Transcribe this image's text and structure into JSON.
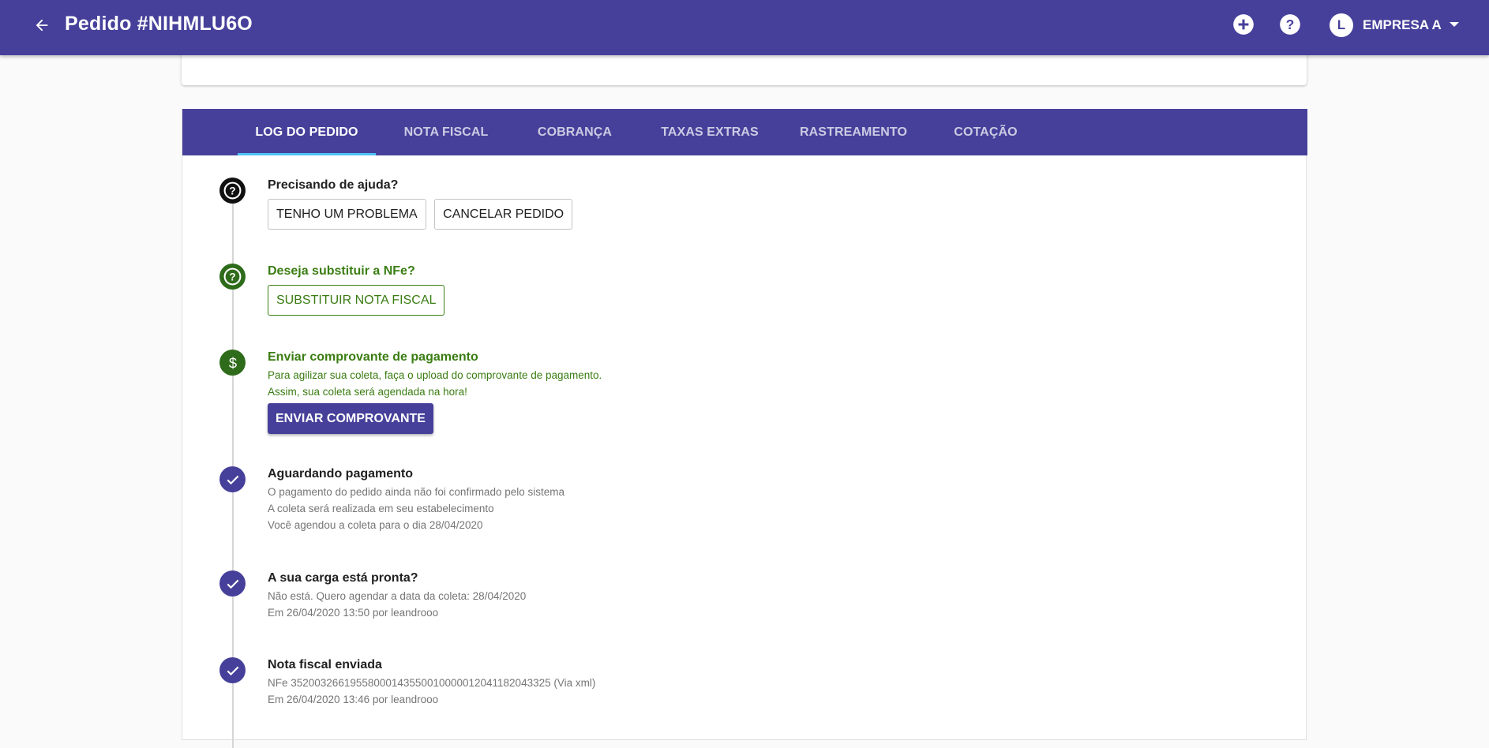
{
  "header": {
    "title": "Pedido #NIHMLU6O",
    "account_initial": "L",
    "account_name": "EMPRESA A"
  },
  "tabs": [
    {
      "label": "LOG DO PEDIDO",
      "active": true
    },
    {
      "label": "NOTA FISCAL",
      "active": false
    },
    {
      "label": "COBRANÇA",
      "active": false
    },
    {
      "label": "TAXAS EXTRAS",
      "active": false
    },
    {
      "label": "RASTREAMENTO",
      "active": false
    },
    {
      "label": "COTAÇÃO",
      "active": false
    }
  ],
  "timeline": {
    "help": {
      "icon": "help-circle-icon",
      "title": "Precisando de ajuda?",
      "button_problem": "TENHO UM PROBLEMA",
      "button_cancel": "CANCELAR PEDIDO"
    },
    "replace_nfe": {
      "icon": "help-circle-icon",
      "title": "Deseja substituir a NFe?",
      "button": "SUBSTITUIR NOTA FISCAL"
    },
    "payment_proof": {
      "icon": "dollar-icon",
      "title": "Enviar comprovante de pagamento",
      "line1": "Para agilizar sua coleta, faça o upload do comprovante de pagamento.",
      "line2": "Assim, sua coleta será agendada na hora!",
      "button": "ENVIAR COMPROVANTE"
    },
    "awaiting_payment": {
      "icon": "check-icon",
      "title": "Aguardando pagamento",
      "line1": "O pagamento do pedido ainda não foi confirmado pelo sistema",
      "line2": "A coleta será realizada em seu estabelecimento",
      "line3": "Você agendou a coleta para o dia 28/04/2020"
    },
    "cargo_ready": {
      "icon": "check-icon",
      "title": "A sua carga está pronta?",
      "line1": "Não está. Quero agendar a data da coleta: 28/04/2020",
      "line2": "Em 26/04/2020 13:50 por leandrooo"
    },
    "invoice_sent": {
      "icon": "check-icon",
      "title": "Nota fiscal enviada",
      "line1": "NFe 35200326619558000143550010000012041182043325 (Via xml)",
      "line2": "Em 26/04/2020 13:46 por leandrooo"
    }
  },
  "colors": {
    "primary": "#46409a",
    "success": "#3a7d12",
    "tab_indicator": "#4fc3f7"
  }
}
